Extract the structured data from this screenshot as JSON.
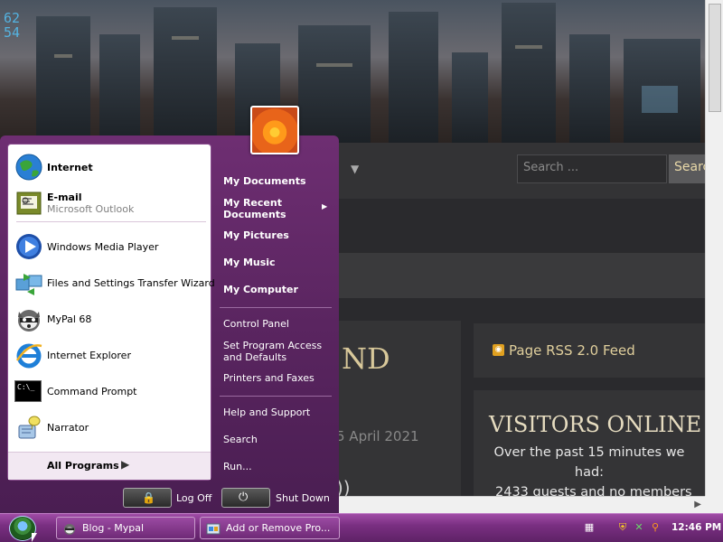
{
  "city_overlay": {
    "digits_line1": "62",
    "digits_line2": "54"
  },
  "website": {
    "search_placeholder": "Search ...",
    "search_button": "Search",
    "heading_fragment": "ND",
    "date_fragment": "5 April 2021",
    "paren_fragment": "))",
    "rss_link": "Page RSS 2.0 Feed",
    "visitors_title": "VISITORS ONLINE",
    "visitors_line1": "Over the past 15 minutes we",
    "visitors_line2": "had:",
    "visitors_line3": "2433 guests and no members"
  },
  "start_menu": {
    "pinned": [
      {
        "title": "Internet",
        "icon": "globe-icon"
      },
      {
        "title": "E-mail",
        "subtitle": "Microsoft Outlook",
        "icon": "email-icon"
      }
    ],
    "recent": [
      {
        "title": "Windows Media Player",
        "icon": "media-player-icon"
      },
      {
        "title": "Files and Settings Transfer Wizard",
        "icon": "transfer-wizard-icon"
      },
      {
        "title": "MyPal 68",
        "icon": "mypal-icon"
      },
      {
        "title": "Internet Explorer",
        "icon": "internet-explorer-icon"
      },
      {
        "title": "Command Prompt",
        "icon": "command-prompt-icon"
      },
      {
        "title": "Narrator",
        "icon": "narrator-icon"
      }
    ],
    "all_programs": "All Programs",
    "places": {
      "my_documents": "My Documents",
      "recent_documents_1": "My Recent",
      "recent_documents_2": "Documents",
      "my_pictures": "My Pictures",
      "my_music": "My Music",
      "my_computer": "My Computer",
      "control_panel": "Control Panel",
      "set_program_1": "Set Program Access",
      "set_program_2": "and Defaults",
      "printers": "Printers and Faxes",
      "help": "Help and Support",
      "search": "Search",
      "run": "Run..."
    },
    "log_off": "Log Off",
    "shut_down": "Shut Down",
    "cmd_icon_text": "C:\\_"
  },
  "taskbar": {
    "buttons": [
      {
        "label": "Blog - Mypal"
      },
      {
        "label": "Add or Remove Pro..."
      }
    ],
    "clock": "12:46 PM"
  },
  "colors": {
    "menu_purple": "#6e2e72",
    "taskbar_purple": "#7a2f82",
    "site_gold": "#e0cf9c"
  }
}
